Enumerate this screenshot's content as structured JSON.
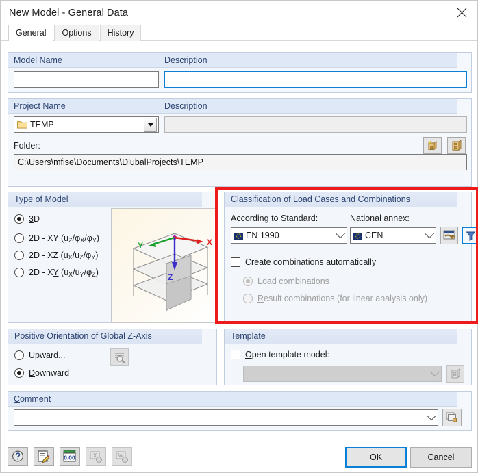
{
  "window": {
    "title": "New Model - General Data",
    "close_icon": "close-icon"
  },
  "tabs": [
    {
      "label": "General",
      "active": true
    },
    {
      "label": "Options",
      "active": false
    },
    {
      "label": "History",
      "active": false
    }
  ],
  "model_section": {
    "name_label_pre": "Model ",
    "name_label_mn": "N",
    "name_label_post": "ame",
    "description_label_pre": "D",
    "description_label_mn": "e",
    "description_label_post": "scription",
    "name_value": "",
    "description_value": ""
  },
  "project_section": {
    "name_label_pre": "",
    "name_label_mn": "P",
    "name_label_post": "roject Name",
    "description_label_pre": "Descripti",
    "description_label_mn": "o",
    "description_label_post": "n",
    "project_value": "TEMP",
    "project_icon": "folder-icon",
    "description_value": "",
    "new_project_button_icon": "new-project-icon",
    "open_project_button_icon": "open-project-icon",
    "folder_label": "Folder:",
    "folder_path": "C:\\Users\\mfise\\Documents\\DlubalProjects\\TEMP"
  },
  "type_of_model": {
    "caption": "Type of Model",
    "options": [
      {
        "pre": "",
        "mn": "3",
        "post": "D",
        "selected": true
      },
      {
        "pre": "2D - ",
        "mn": "X",
        "post": "Y (u",
        "sub1": "Z",
        "mid": "/φ",
        "sub2": "X",
        "mid2": "/φ",
        "sub3": "Y",
        "end": ")",
        "selected": false
      },
      {
        "pre": "",
        "mn": "2",
        "post": "D - XZ (u",
        "sub1": "X",
        "mid": "/u",
        "sub2": "Z",
        "mid2": "/φ",
        "sub3": "Y",
        "end": ")",
        "selected": false
      },
      {
        "pre": "2D - X",
        "mn": "Y",
        "post": " (u",
        "sub1": "X",
        "mid": "/u",
        "sub2": "Y",
        "mid2": "/φ",
        "sub3": "Z",
        "end": ")",
        "selected": false
      }
    ],
    "preview_axes": {
      "x": "X",
      "y": "Y",
      "z": "Z"
    },
    "preview_icon": "model-3d-preview"
  },
  "classification": {
    "caption": "Classification of Load Cases and Combinations",
    "standard_label_pre": "",
    "standard_label_mn": "A",
    "standard_label_post": "ccording to Standard:",
    "standard_value": "EN 1990",
    "standard_icon": "eu-flag-icon",
    "annex_label_pre": "National anne",
    "annex_label_mn": "x",
    "annex_label_post": ":",
    "annex_value": "CEN",
    "annex_icon": "eu-flag-icon",
    "settings_button_icon": "standard-settings-icon",
    "filter_button_icon": "filter-funnel-icon",
    "auto_combinations_pre": "Crea",
    "auto_combinations_mn": "t",
    "auto_combinations_post": "e combinations automatically",
    "auto_combinations_checked": false,
    "sub_options": [
      {
        "pre": "",
        "mn": "L",
        "post": "oad combinations",
        "selected": true,
        "disabled": true
      },
      {
        "pre": "",
        "mn": "R",
        "post": "esult combinations (for linear analysis only)",
        "selected": false,
        "disabled": true
      }
    ],
    "highlight_color": "#ee1b1b"
  },
  "z_axis": {
    "caption": "Positive Orientation of Global Z-Axis",
    "options": [
      {
        "pre": "",
        "mn": "U",
        "post": "pward...",
        "selected": false
      },
      {
        "pre": "",
        "mn": "D",
        "post": "ownward",
        "selected": true
      }
    ],
    "preview_button_icon": "axis-preview-icon"
  },
  "template": {
    "caption": "Template",
    "open_label_pre": "",
    "open_label_mn": "O",
    "open_label_post": "pen template model:",
    "open_checked": false,
    "model_value": "",
    "browse_button_icon": "open-model-icon"
  },
  "comment": {
    "label_pre": "",
    "label_mn": "C",
    "label_post": "omment",
    "value": "",
    "picker_button_icon": "comment-library-icon"
  },
  "footer": {
    "tools": [
      {
        "icon": "help-icon",
        "disabled": false
      },
      {
        "icon": "edit-note-icon",
        "disabled": false
      },
      {
        "icon": "units-icon",
        "label": "0.00",
        "disabled": false
      },
      {
        "icon": "export-excel-icon",
        "disabled": true
      },
      {
        "icon": "export-word-icon",
        "disabled": true
      }
    ],
    "ok_label": "OK",
    "cancel_label": "Cancel"
  }
}
